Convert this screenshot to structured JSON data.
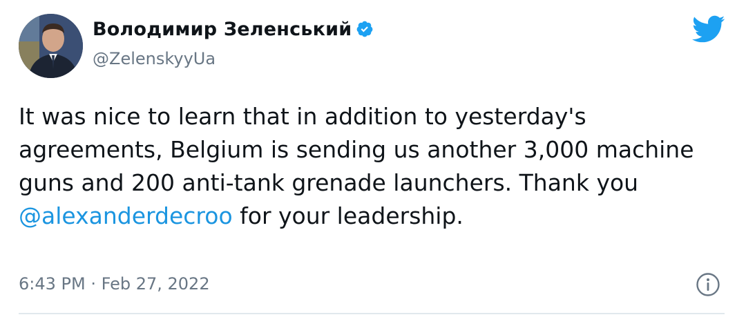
{
  "author": {
    "display_name": "Володимир Зеленський",
    "handle": "@ZelenskyyUa",
    "verified": true,
    "avatar_icon": "profile-photo"
  },
  "platform": {
    "logo_icon": "twitter-bird-icon",
    "brand_color": "#1da1f2"
  },
  "tweet": {
    "text_before": "It was nice to learn that in addition to yesterday's agreements, Belgium is sending us another 3,000 machine guns and 200 anti-tank grenade launchers. Thank you ",
    "mention": "@alexanderdecroo",
    "text_after": " for your leadership.",
    "mention_color": "#1b95e0"
  },
  "meta": {
    "timestamp": "6:43 PM · Feb 27, 2022",
    "info_icon": "info-icon"
  }
}
